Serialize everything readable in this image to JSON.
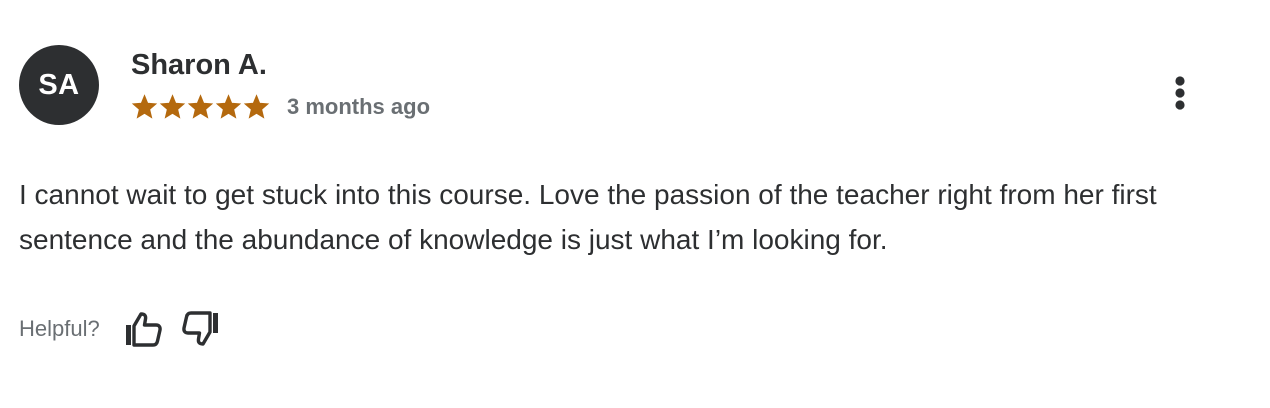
{
  "review": {
    "avatar_initials": "SA",
    "author_name": "Sharon A.",
    "rating": 5,
    "rating_max": 5,
    "time_ago": "3 months ago",
    "text": "I cannot wait to get stuck into this course. Love the passion of the teacher right from her first sentence and the abundance of knowledge is just what I’m looking for.",
    "helpful_label": "Helpful?",
    "icons": {
      "more": "more-vertical-icon",
      "thumbs_up": "thumbs-up-icon",
      "thumbs_down": "thumbs-down-icon",
      "star": "star-icon"
    }
  },
  "colors": {
    "star": "#b4690e",
    "avatar_bg": "#2d2f31",
    "text": "#2d2f31",
    "muted": "#6a6f73"
  }
}
